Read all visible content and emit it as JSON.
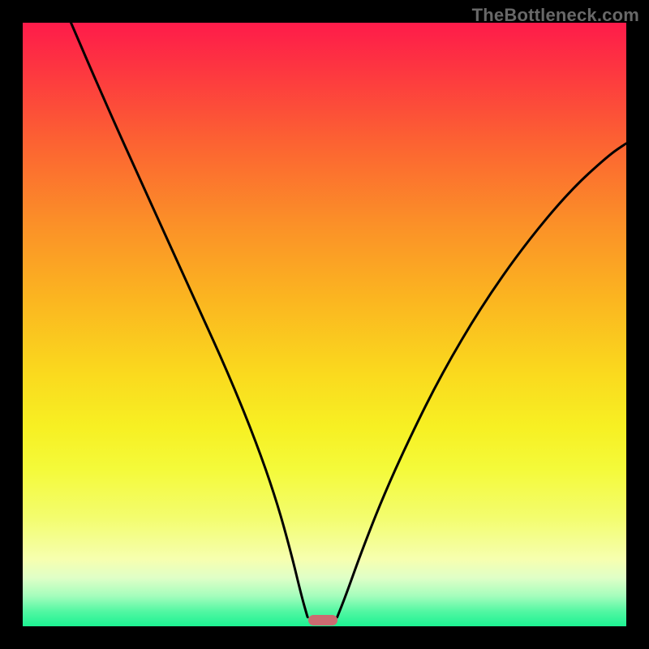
{
  "watermark": "TheBottleneck.com",
  "chart_data": {
    "type": "line",
    "title": "",
    "xlabel": "",
    "ylabel": "",
    "left_branch": [
      {
        "x_frac": 0.08,
        "y": 100
      },
      {
        "x_frac": 0.11,
        "y": 93
      },
      {
        "x_frac": 0.145,
        "y": 85
      },
      {
        "x_frac": 0.19,
        "y": 75
      },
      {
        "x_frac": 0.24,
        "y": 64
      },
      {
        "x_frac": 0.29,
        "y": 53
      },
      {
        "x_frac": 0.34,
        "y": 42
      },
      {
        "x_frac": 0.385,
        "y": 31
      },
      {
        "x_frac": 0.42,
        "y": 21
      },
      {
        "x_frac": 0.445,
        "y": 12
      },
      {
        "x_frac": 0.462,
        "y": 5
      },
      {
        "x_frac": 0.472,
        "y": 1.5
      }
    ],
    "right_branch": [
      {
        "x_frac": 0.521,
        "y": 1.5
      },
      {
        "x_frac": 0.535,
        "y": 5
      },
      {
        "x_frac": 0.56,
        "y": 12
      },
      {
        "x_frac": 0.595,
        "y": 21
      },
      {
        "x_frac": 0.64,
        "y": 31
      },
      {
        "x_frac": 0.695,
        "y": 42
      },
      {
        "x_frac": 0.76,
        "y": 53
      },
      {
        "x_frac": 0.83,
        "y": 63
      },
      {
        "x_frac": 0.905,
        "y": 72
      },
      {
        "x_frac": 0.97,
        "y": 78
      },
      {
        "x_frac": 1.0,
        "y": 80
      }
    ],
    "ylim": [
      0,
      100
    ],
    "minimum_marker": {
      "x_frac": 0.497,
      "color": "#cc6b71"
    }
  },
  "colors": {
    "stroke": "#000000",
    "marker": "#cc6b71"
  }
}
